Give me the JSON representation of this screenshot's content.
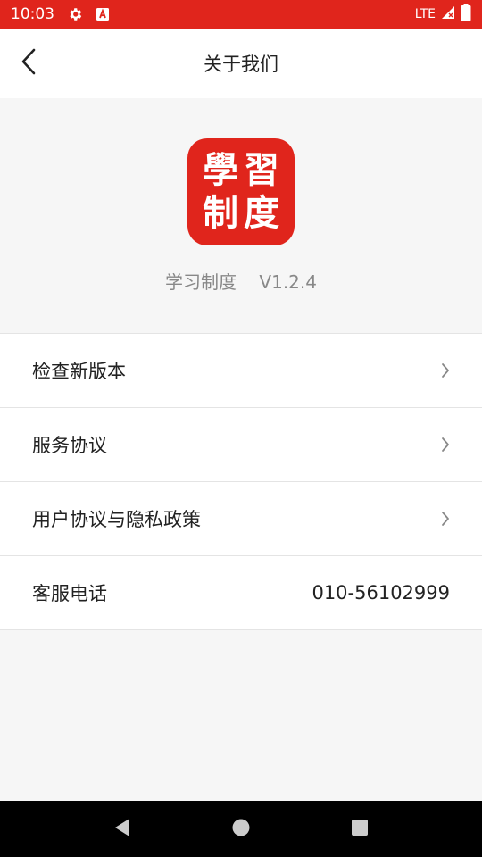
{
  "status_bar": {
    "time": "10:03",
    "network": "LTE",
    "icons": [
      "gear-icon",
      "a-box-icon",
      "signal-icon",
      "battery-icon"
    ]
  },
  "app_bar": {
    "title": "关于我们",
    "back_icon": "back-chevron-icon"
  },
  "app_info": {
    "logo_chars": [
      "學",
      "習",
      "制",
      "度"
    ],
    "name": "学习制度",
    "version": "V1.2.4"
  },
  "menu": {
    "items": [
      {
        "label": "检查新版本"
      },
      {
        "label": "服务协议"
      },
      {
        "label": "用户协议与隐私政策"
      },
      {
        "label": "客服电话",
        "value": "010-56102999"
      }
    ]
  },
  "nav_bar": {
    "icons": [
      "back-triangle-icon",
      "home-circle-icon",
      "recents-square-icon"
    ]
  },
  "colors": {
    "accent": "#e0251c",
    "background": "#f6f6f6"
  }
}
